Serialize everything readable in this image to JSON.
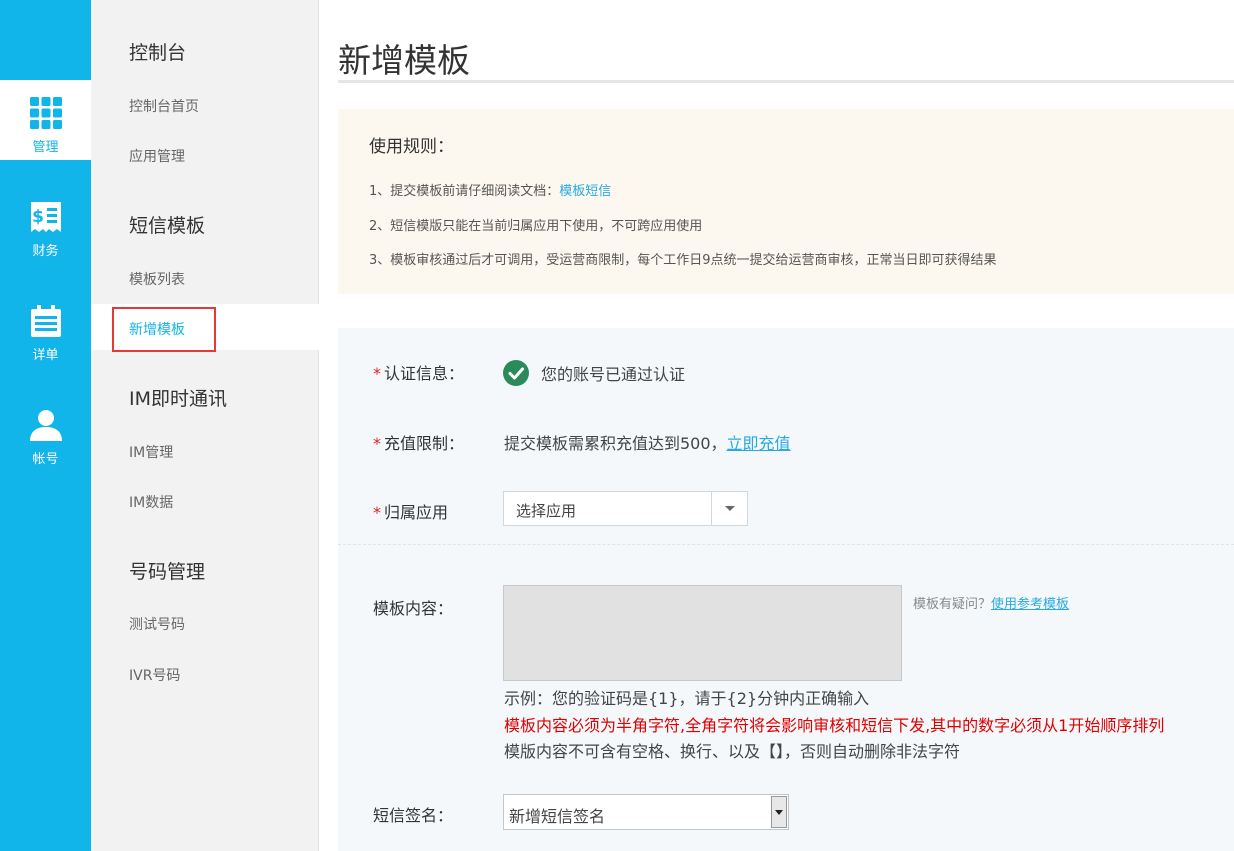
{
  "rail": {
    "items": [
      {
        "label": "管理",
        "icon": "grid-icon"
      },
      {
        "label": "财务",
        "icon": "bill-icon"
      },
      {
        "label": "详单",
        "icon": "calendar-icon"
      },
      {
        "label": "帐号",
        "icon": "user-icon"
      }
    ]
  },
  "sidebar": {
    "groups": [
      {
        "title": "控制台",
        "links": [
          "控制台首页",
          "应用管理"
        ]
      },
      {
        "title": "短信模板",
        "links": [
          "模板列表",
          "新增模板"
        ]
      },
      {
        "title": "IM即时通讯",
        "links": [
          "IM管理",
          "IM数据"
        ]
      },
      {
        "title": "号码管理",
        "links": [
          "测试号码",
          "IVR号码"
        ]
      }
    ]
  },
  "page": {
    "title": "新增模板"
  },
  "rules": {
    "heading": "使用规则：",
    "line1_prefix": "1、提交模板前请仔细阅读文档：",
    "line1_link": "模板短信",
    "line2": "2、短信模版只能在当前归属应用下使用，不可跨应用使用",
    "line3": "3、模板审核通过后才可调用，受运营商限制，每个工作日9点统一提交给运营商审核，正常当日即可获得结果"
  },
  "form": {
    "auth_label": "认证信息：",
    "auth_value": "您的账号已通过认证",
    "recharge_label": "充值限制：",
    "recharge_text": "提交模板需累积充值达到500，",
    "recharge_link": "立即充值",
    "app_label": "归属应用",
    "app_select": "选择应用",
    "content_label": "模板内容：",
    "help_prefix": "模板有疑问？",
    "help_link": "使用参考模板",
    "example": "示例：您的验证码是{1}，请于{2}分钟内正确输入",
    "warning": "模板内容必须为半角字符,全角字符将会影响审核和短信下发,其中的数字必须从1开始顺序排列",
    "note": "模版内容不可含有空格、换行、以及【】，否则自动删除非法字符",
    "sign_label": "短信签名：",
    "sign_select": "新增短信签名"
  },
  "colors": {
    "accent": "#11b5ea",
    "warning": "#e00000",
    "link": "#28a9e3",
    "check": "#2b8a5a"
  }
}
